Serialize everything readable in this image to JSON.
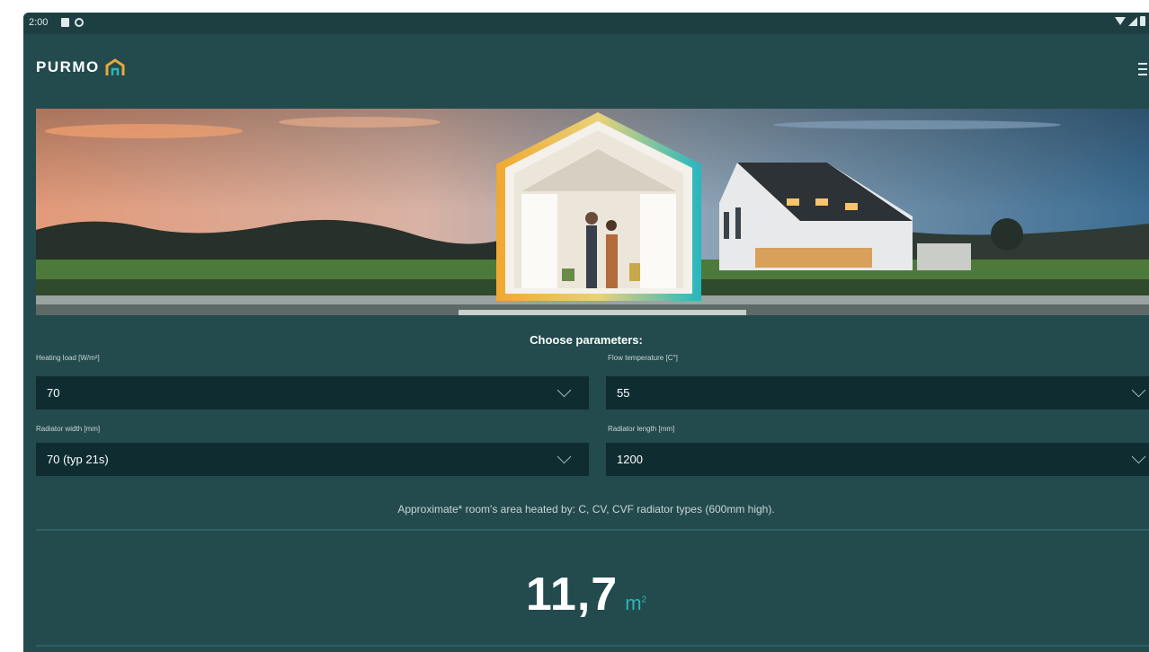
{
  "status_bar": {
    "time": "2:00"
  },
  "app": {
    "brand": "PURMO"
  },
  "form": {
    "title": "Choose parameters:",
    "heating_load": {
      "label": "Heating load [W/m²]",
      "value": "70"
    },
    "flow_temperature": {
      "label": "Flow temperature [C°]",
      "value": "55"
    },
    "radiator_width": {
      "label": "Radiator width [mm]",
      "value": "70 (typ 21s)"
    },
    "radiator_length": {
      "label": "Radiator length [mm]",
      "value": "1200"
    }
  },
  "note": "Approximate* room's area heated by: C, CV, CVF radiator types (600mm high).",
  "result": {
    "value": "11,7",
    "unit": "m",
    "unit_exp": "2"
  },
  "colors": {
    "background": "#234a4d",
    "field": "#0f2d31",
    "accent": "#2fb6b5"
  }
}
